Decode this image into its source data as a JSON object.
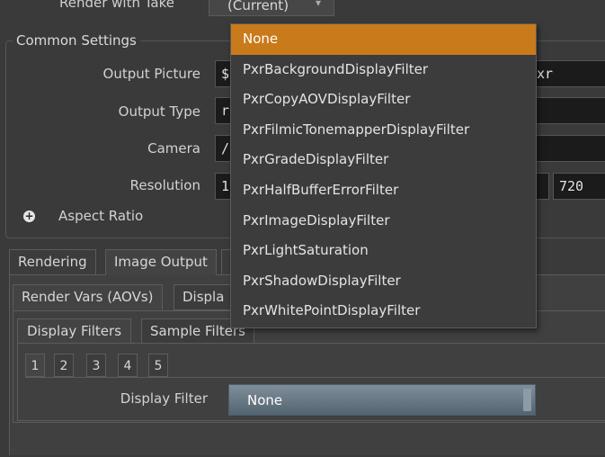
{
  "top": {
    "render_with_take_label": "Render with Take",
    "render_with_take_value": "(Current)"
  },
  "common_settings": {
    "title": "Common Settings",
    "output_picture": {
      "label": "Output Picture",
      "value_left": "$",
      "value_right": "xr"
    },
    "output_type": {
      "label": "Output Type",
      "value_left": "r"
    },
    "camera": {
      "label": "Camera",
      "value_left": "/"
    },
    "resolution": {
      "label": "Resolution",
      "value_left": "1",
      "value_height": "720"
    },
    "aspect_ratio": {
      "label": "Aspect Ratio"
    }
  },
  "tabs_level1": [
    "Rendering",
    "Image Output"
  ],
  "tabs_level2": [
    "Render Vars (AOVs)",
    "Displa"
  ],
  "tabs_level3": [
    "Display Filters",
    "Sample Filters"
  ],
  "number_tabs": [
    "1",
    "2",
    "3",
    "4",
    "5"
  ],
  "display_filter": {
    "label": "Display Filter",
    "value": "None"
  },
  "dropdown": {
    "items": [
      "None",
      "PxrBackgroundDisplayFilter",
      "PxrCopyAOVDisplayFilter",
      "PxrFilmicTonemapperDisplayFilter",
      "PxrGradeDisplayFilter",
      "PxrHalfBufferErrorFilter",
      "PxrImageDisplayFilter",
      "PxrLightSaturation",
      "PxrShadowDisplayFilter",
      "PxrWhitePointDisplayFilter"
    ],
    "selected": "None"
  },
  "colors": {
    "highlight": "#c97a1a",
    "field_bg": "#1b1b1b",
    "panel_bg": "#3a3a3a"
  }
}
